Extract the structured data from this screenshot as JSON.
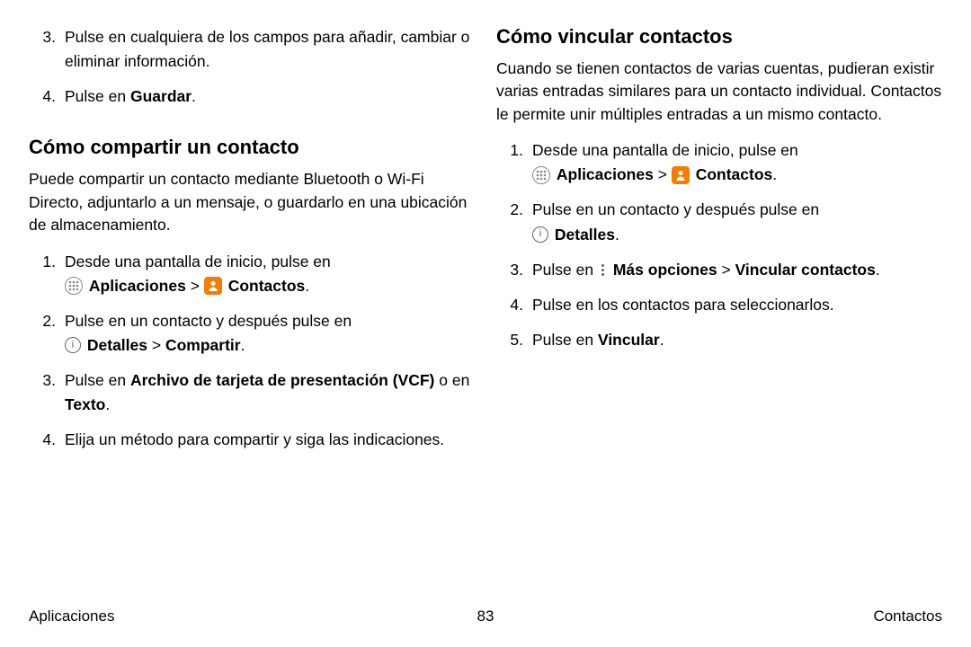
{
  "left": {
    "pre_steps": [
      {
        "num": "3.",
        "text": "Pulse en cualquiera de los campos para añadir, cambiar o eliminar información."
      },
      {
        "num": "4.",
        "text_pre": "Pulse en ",
        "bold": "Guardar",
        "text_post": "."
      }
    ],
    "heading": "Cómo compartir un contacto",
    "para": "Puede compartir un contacto mediante Bluetooth o Wi-Fi Directo, adjuntarlo a un mensaje, o guardarlo en una ubicación de almacenamiento.",
    "steps": {
      "s1": {
        "num": "1.",
        "line1": "Desde una pantalla de inicio, pulse en",
        "apps": "Aplicaciones",
        "chev": ">",
        "contacts": "Contactos",
        "dot": "."
      },
      "s2": {
        "num": "2.",
        "line1": "Pulse en un contacto y después pulse en",
        "details": "Detalles",
        "chev": ">",
        "share": "Compartir",
        "dot": "."
      },
      "s3": {
        "num": "3.",
        "pre": "Pulse en ",
        "vcf": "Archivo de tarjeta de presentación (VCF)",
        "mid": " o en ",
        "texto": "Texto",
        "dot": "."
      },
      "s4": {
        "num": "4.",
        "text": "Elija un método para compartir y siga las indicaciones."
      }
    }
  },
  "right": {
    "heading": "Cómo vincular contactos",
    "para": "Cuando se tienen contactos de varias cuentas, pudieran existir varias entradas similares para un contacto individual. Contactos le permite unir múltiples entradas a un mismo contacto.",
    "steps": {
      "s1": {
        "num": "1.",
        "line1": "Desde una pantalla de inicio, pulse en",
        "apps": "Aplicaciones",
        "chev": ">",
        "contacts": "Contactos",
        "dot": "."
      },
      "s2": {
        "num": "2.",
        "line1": "Pulse en un contacto y después pulse en",
        "details": "Detalles",
        "dot": "."
      },
      "s3": {
        "num": "3.",
        "pre": "Pulse en ",
        "more": "Más opciones",
        "chev": ">",
        "link": "Vincular contactos",
        "dot": "."
      },
      "s4": {
        "num": "4.",
        "text": "Pulse en los contactos para seleccionarlos."
      },
      "s5": {
        "num": "5.",
        "pre": "Pulse en ",
        "bold": "Vincular",
        "dot": "."
      }
    }
  },
  "footer": {
    "left": "Aplicaciones",
    "center": "83",
    "right": "Contactos"
  }
}
